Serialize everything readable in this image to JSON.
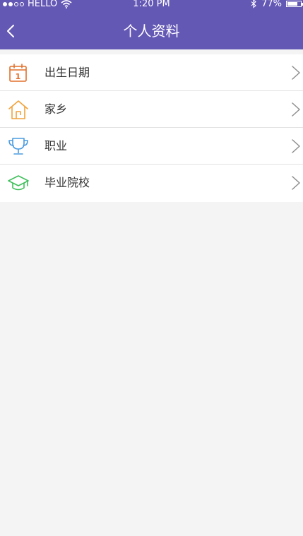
{
  "status_bar": {
    "carrier": "HELLO",
    "time": "1:20 PM",
    "battery_percent": "77%",
    "battery_level": 0.77,
    "signal_bars_filled": 2,
    "signal_bars_total": 4,
    "icons": [
      "wifi-icon",
      "bluetooth-icon",
      "battery-icon"
    ]
  },
  "navbar": {
    "title": "个人资料",
    "back_icon": "chevron-left-icon",
    "background_color": "#6458b5"
  },
  "profile_items": [
    {
      "label": "出生日期",
      "icon": "calendar-icon",
      "icon_color": "#e2702c",
      "icon_text": "1"
    },
    {
      "label": "家乡",
      "icon": "house-icon",
      "icon_color": "#f2a23a"
    },
    {
      "label": "职业",
      "icon": "trophy-icon",
      "icon_color": "#4a9be0"
    },
    {
      "label": "毕业院校",
      "icon": "graduation-cap-icon",
      "icon_color": "#3fbf5a"
    }
  ],
  "chevron_icon": "chevron-right-icon"
}
